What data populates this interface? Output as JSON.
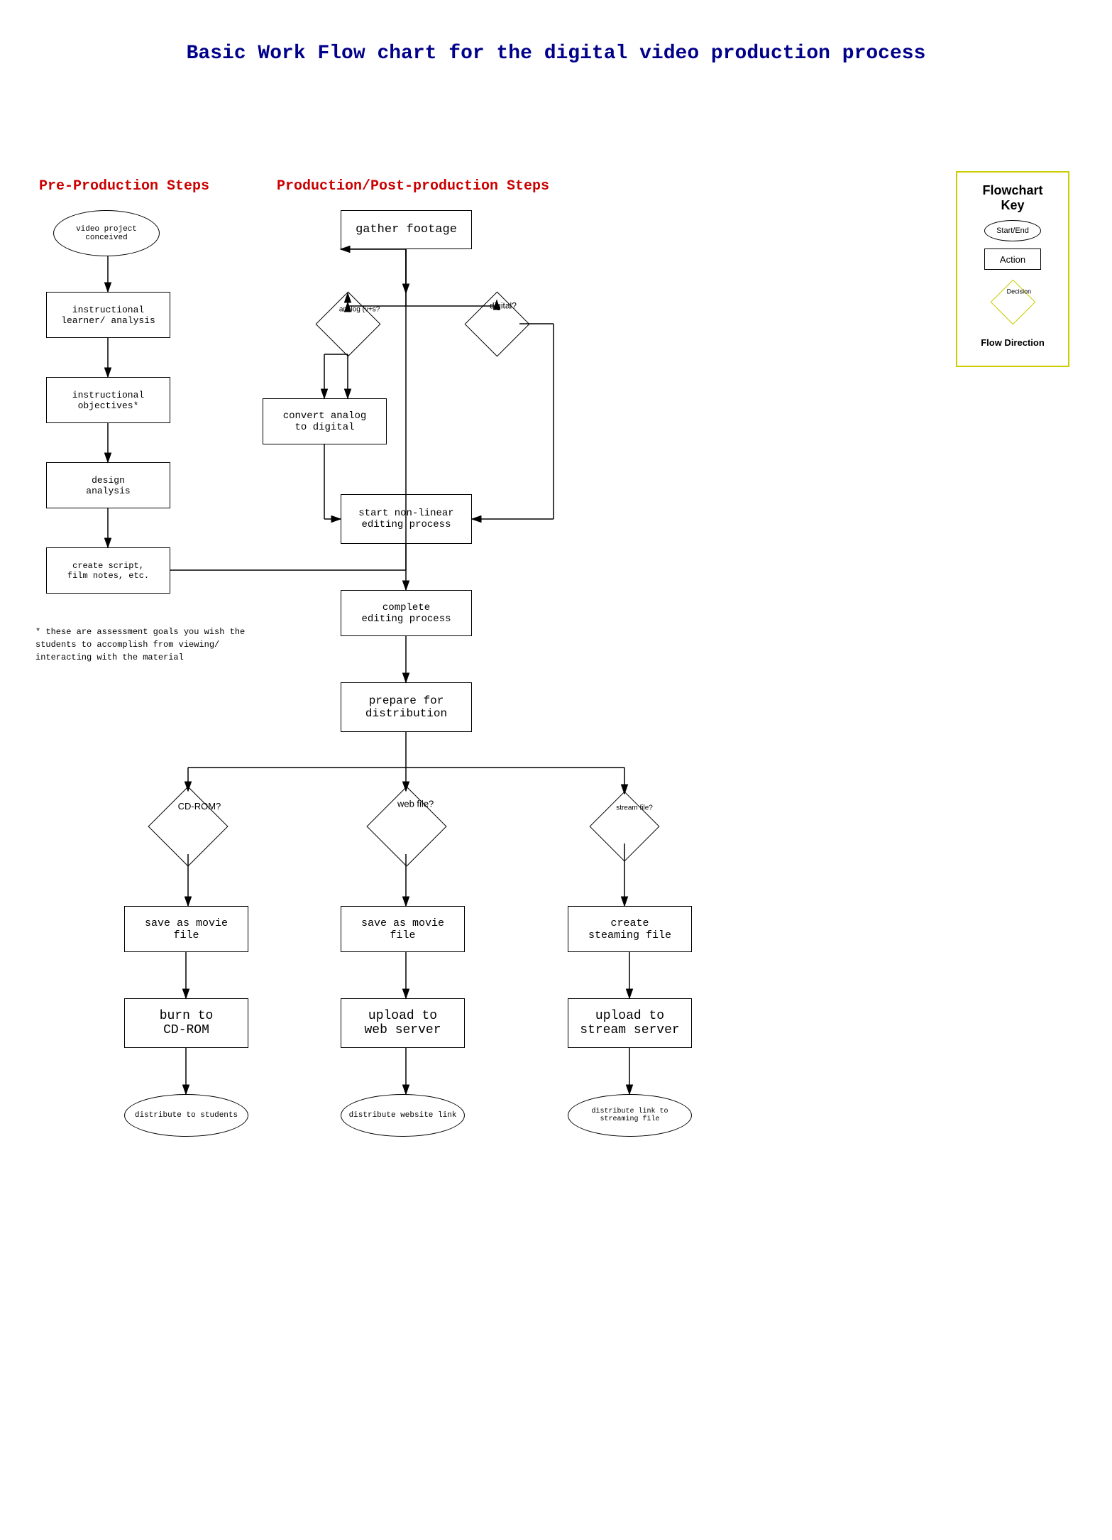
{
  "title": "Basic Work Flow chart for the digital video production process",
  "sections": {
    "pre_production": "Pre-Production Steps",
    "production": "Production/Post-production Steps"
  },
  "key": {
    "title": "Flowchart Key",
    "start_end": "Start/End",
    "action": "Action",
    "decision": "Decision",
    "flow": "Flow Direction"
  },
  "nodes": {
    "video_project": "video project\nconceived",
    "instructional_learner": "instructional\nlearner/ analysis",
    "instructional_objectives": "instructional\nobjectives*",
    "design_analysis": "design\nanalysis",
    "create_script": "create script,\nfilm notes, etc.",
    "gather_footage": "gather footage",
    "analog": "analog (v+s?",
    "digital": "digital?",
    "convert_analog": "convert analog\nto digital",
    "start_nonlinear": "start non-linear\nediting process",
    "complete_editing": "complete\nediting process",
    "prepare_distribution": "prepare for\ndistribution",
    "cdrom_question": "CD-ROM?",
    "web_question": "web file?",
    "stream_question": "stream\nfile?",
    "save_movie_cdrom": "save as movie\nfile",
    "save_movie_web": "save as movie\nfile",
    "create_streaming": "create\nsteaming file",
    "burn_cdrom": "burn to\nCD-ROM",
    "upload_web": "upload to\nweb server",
    "upload_stream": "upload to\nstream server",
    "distribute_students": "distribute to students",
    "distribute_website": "distribute website link",
    "distribute_streaming": "distribute link to\nstreaming file"
  },
  "note": "* these are assessment goals you wish the\nstudents to accomplish from viewing/ interacting\nwith the material"
}
